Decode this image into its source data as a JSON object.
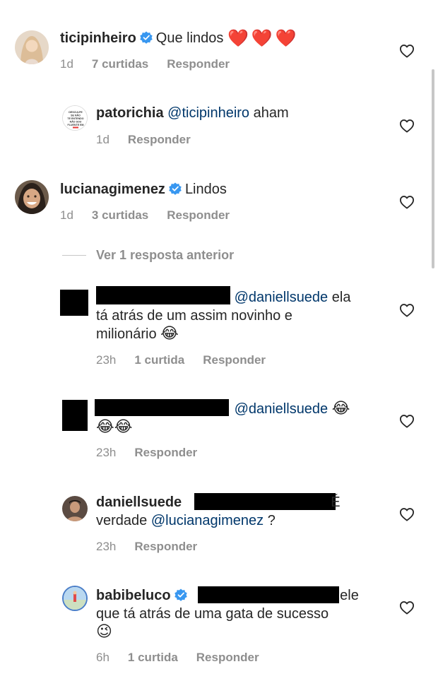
{
  "comments": [
    {
      "username": "ticipinheiro",
      "text": "Que lindos",
      "hearts": "❤️❤️❤️",
      "time": "1d",
      "likes": "7 curtidas",
      "reply": "Responder"
    },
    {
      "username": "patorichia",
      "mention": "@ticipinheiro",
      "text": "aham",
      "time": "1d",
      "reply": "Responder",
      "avatar_lines": [
        "DESCULPE",
        "SE NÃO",
        "TE ENTENDO",
        "NÃO SOU",
        "FLUENTE EM"
      ]
    },
    {
      "username": "lucianagimenez",
      "text": "Lindos",
      "time": "1d",
      "likes": "3 curtidas",
      "reply": "Responder"
    },
    {
      "mention": "@daniellsuede",
      "text_a": "ela",
      "text_b": "tá atrás de um assim novinho e",
      "text_c": "milionário",
      "emoji": "😂",
      "time": "23h",
      "likes": "1 curtida",
      "reply": "Responder"
    },
    {
      "mention": "@daniellsuede",
      "emoji": "😂",
      "emoji_line2": "😂😂",
      "time": "23h",
      "reply": "Responder"
    },
    {
      "username": "daniellsuede",
      "text_a": "É",
      "text_b": "verdade",
      "mention": "@lucianagimenez",
      "text_c": "?",
      "time": "23h",
      "reply": "Responder"
    },
    {
      "username": "babibeluco",
      "text_a": "ele",
      "text_b": "que tá atrás de uma gata de sucesso",
      "emoji": "😉",
      "time": "6h",
      "likes": "1 curtida",
      "reply": "Responder"
    }
  ],
  "view_replies": "Ver 1 resposta anterior",
  "icons": {
    "like": "heart-outline-icon",
    "verified": "verified-badge-icon"
  },
  "colors": {
    "mention": "#00376b",
    "verified": "#3897f0",
    "meta": "#8e8e8e"
  }
}
